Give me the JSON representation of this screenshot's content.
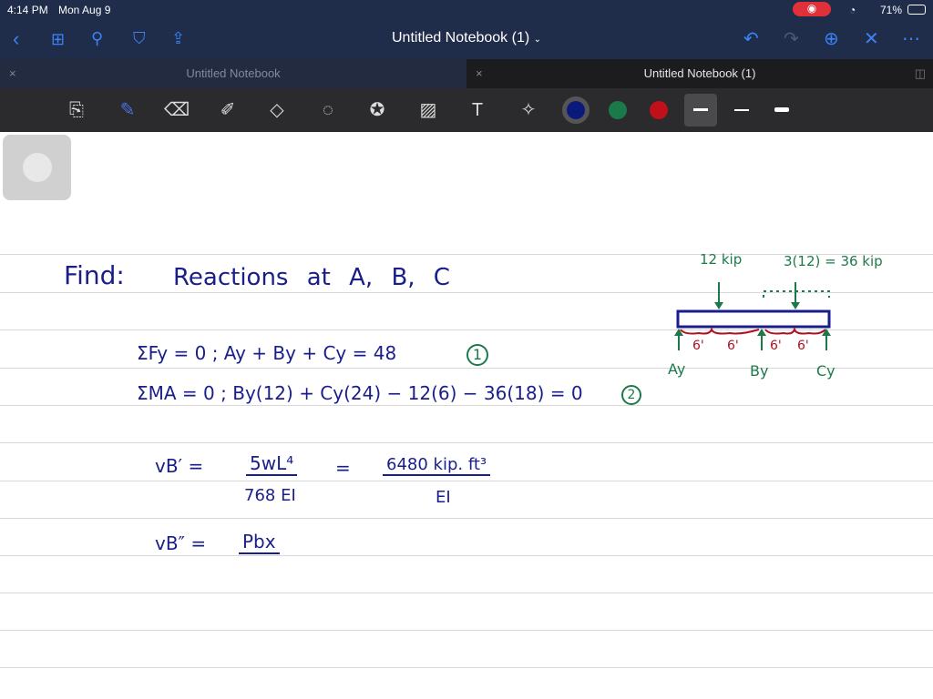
{
  "status": {
    "time": "4:14 PM",
    "date": "Mon Aug 9",
    "battery": "71%"
  },
  "header": {
    "title": "Untitled Notebook (1)"
  },
  "tabs": [
    {
      "label": "Untitled Notebook"
    },
    {
      "label": "Untitled Notebook (1)"
    }
  ],
  "colors": {
    "blue": "#0a1a7a",
    "green": "#1a7a4a",
    "red": "#c0101a"
  },
  "note": {
    "find": "Find:",
    "reactions": "Reactions at A, B, C",
    "eq1": "ΣFy = 0 ;   Ay + By + Cy  =  48",
    "eq1_tag": "1",
    "eq2": "ΣMA = 0 ;   By(12) + Cy(24) − 12(6) − 36(18) = 0",
    "eq2_tag": "2",
    "vb1": "vB′  =",
    "f1_num": "5wL⁴",
    "f1_den": "768 EI",
    "eq": "=",
    "f2_num": "6480 kip. ft³",
    "f2_den": "EI",
    "vb2": "vB″  =",
    "f3_num": "Pbx"
  },
  "diagram": {
    "load1": "12 kip",
    "load2": "3(12) = 36 kip",
    "span": "6'",
    "ay": "Ay",
    "by": "By",
    "cy": "Cy"
  }
}
